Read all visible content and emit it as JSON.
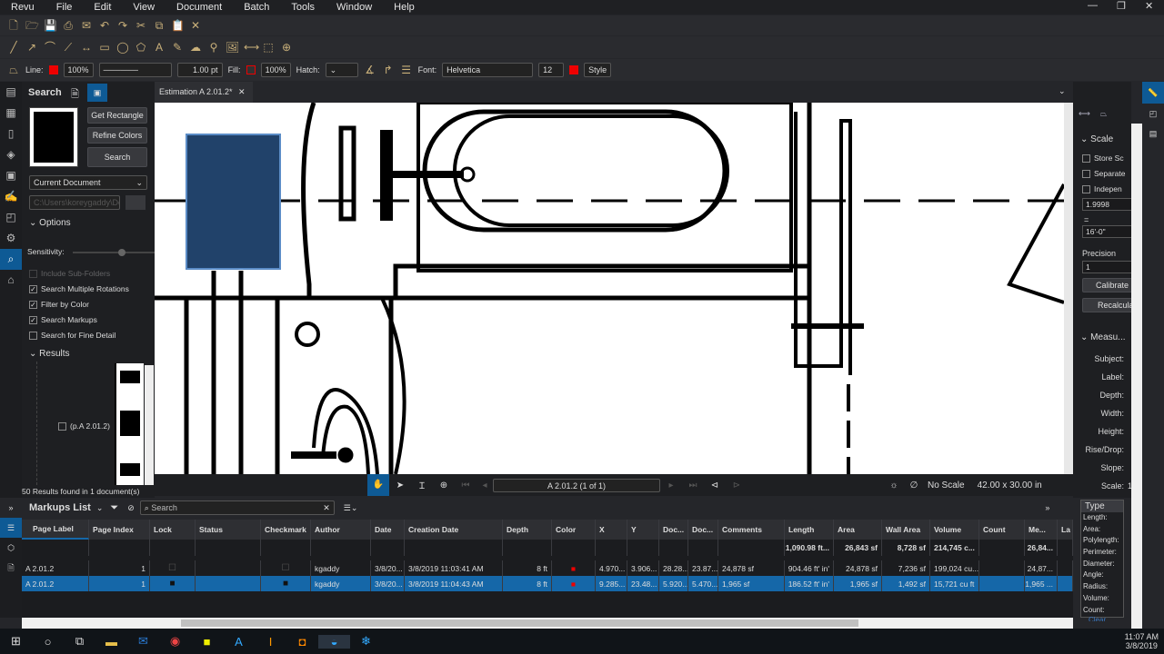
{
  "menu": [
    "Revu",
    "File",
    "Edit",
    "View",
    "Document",
    "Batch",
    "Tools",
    "Window",
    "Help"
  ],
  "props": {
    "line_label": "Line:",
    "line_opacity": "100%",
    "line_width": "1.00 pt",
    "fill_label": "Fill:",
    "fill_opacity": "100%",
    "hatch_label": "Hatch:",
    "font_label": "Font:",
    "font": "Helvetica",
    "font_size": "12",
    "style": "Style",
    "color": "#e00000"
  },
  "search_panel": {
    "title": "Search",
    "get_rectangle": "Get Rectangle",
    "refine_colors": "Refine Colors",
    "search": "Search",
    "scope": "Current Document",
    "path_placeholder": "C:\\Users\\koreygaddy\\Do",
    "options": "Options",
    "sensitivity": "Sensitivity:",
    "sensitivity_value": 0.6,
    "checks": [
      {
        "label": "Include Sub-Folders",
        "checked": false,
        "disabled": true
      },
      {
        "label": "Search Multiple Rotations",
        "checked": true
      },
      {
        "label": "Filter by Color",
        "checked": true
      },
      {
        "label": "Search Markups",
        "checked": true
      },
      {
        "label": "Search for Fine Detail",
        "checked": false
      }
    ],
    "results": "Results",
    "result_item": "(p.A 2.01.2)",
    "summary": "50 Results found in 1 document(s)"
  },
  "doc_tab": "Estimation A 2.01.2*",
  "nav": {
    "page": "A 2.01.2 (1 of 1)",
    "scale": "No Scale",
    "size": "42.00 x 30.00 in"
  },
  "right_panel": {
    "scale": "Scale",
    "store": "Store Sc",
    "separate": "Separate",
    "independent": "Indepen",
    "value1": "1.9998",
    "eq": "=",
    "value2": "16'-0\"",
    "precision_label": "Precision",
    "precision": "1",
    "calibrate": "Calibrate",
    "recalculate": "Recalcula",
    "measurements": "Measu...",
    "fields": [
      "Subject:",
      "Label:",
      "Depth:",
      "Width:",
      "Height:",
      "Rise/Drop:",
      "Slope:",
      "Scale:"
    ],
    "scale_val": "1"
  },
  "markups": {
    "title": "Markups List",
    "search_placeholder": "Search",
    "columns": [
      "Page Label",
      "Page Index",
      "Lock",
      "Status",
      "Checkmark",
      "Author",
      "Date",
      "Creation Date",
      "Depth",
      "Color",
      "X",
      "Y",
      "Doc...",
      "Doc...",
      "Comments",
      "Length",
      "Area",
      "Wall Area",
      "Volume",
      "Count",
      "Me...",
      "La"
    ],
    "totals": [
      "",
      "",
      "",
      "",
      "",
      "",
      "",
      "",
      "",
      "",
      "",
      "",
      "",
      "",
      "",
      "1,090.98 ft...",
      "26,843 sf",
      "8,728 sf",
      "214,745 c...",
      "",
      "26,84...",
      ""
    ],
    "rows": [
      [
        "A 2.01.2",
        "1",
        "☐",
        "",
        "☐",
        "kgaddy",
        "3/8/20...",
        "3/8/2019 11:03:41 AM",
        "8 ft",
        "■",
        "4.970...",
        "3.906...",
        "28.28...",
        "23.87...",
        "24,878 sf",
        "904.46 ft' in'",
        "24,878 sf",
        "7,236 sf",
        "199,024 cu...",
        "",
        "24,87...",
        ""
      ],
      [
        "A 2.01.2",
        "1",
        "■",
        "",
        "■",
        "kgaddy",
        "3/8/20...",
        "3/8/2019 11:04:43 AM",
        "8 ft",
        "■",
        "9.285...",
        "23.48...",
        "5.920...",
        "5.470...",
        "1,965 sf",
        "186.52 ft' in'",
        "1,965 sf",
        "1,492 sf",
        "15,721 cu ft",
        "",
        "1,965 ...",
        ""
      ]
    ],
    "selected_row": 1
  },
  "type_filter": {
    "header": "Type",
    "items": [
      "Length:",
      "Area:",
      "Polylength:",
      "Perimeter:",
      "Diameter:",
      "Angle:",
      "Radius:",
      "Volume:",
      "Count:"
    ],
    "clear": "Clear"
  },
  "clock": {
    "time": "11:07 AM",
    "date": "3/8/2019"
  }
}
